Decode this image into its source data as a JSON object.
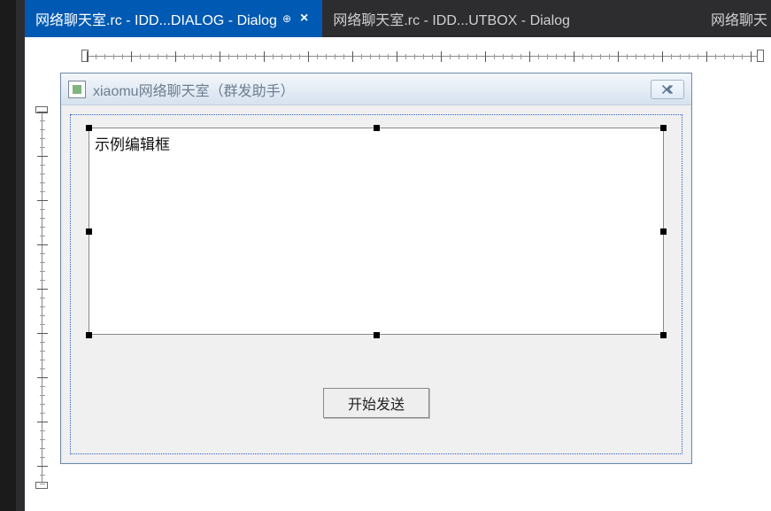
{
  "tabs": {
    "active": {
      "label": "网络聊天室.rc - IDD...DIALOG - Dialog"
    },
    "inactive": {
      "label": "网络聊天室.rc - IDD...UTBOX - Dialog"
    },
    "overflow": {
      "label": "网络聊天"
    }
  },
  "dialog": {
    "title": "xiaomu网络聊天室（群发助手）",
    "close_glyph": "✕"
  },
  "editBox": {
    "text": "示例编辑框"
  },
  "buttons": {
    "send_label": "开始发送"
  }
}
